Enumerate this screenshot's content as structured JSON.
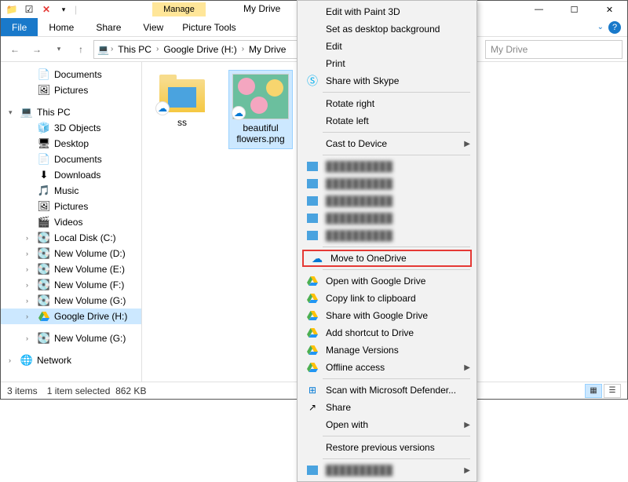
{
  "titlebar": {
    "manage": "Manage",
    "title": "My Drive",
    "min": "—",
    "max": "☐",
    "close": "✕"
  },
  "menu": {
    "file": "File",
    "home": "Home",
    "share": "Share",
    "view": "View",
    "picture_tools": "Picture Tools"
  },
  "nav": {
    "back": "←",
    "fwd": "→",
    "up": "↑",
    "crumbs": [
      "This PC",
      "Google Drive (H:)",
      "My Drive"
    ],
    "search_placeholder": "My Drive"
  },
  "tree": [
    {
      "icon": "📄",
      "label": "Documents",
      "sub": true
    },
    {
      "icon": "🖼",
      "label": "Pictures",
      "sub": true
    },
    {
      "spacer": true
    },
    {
      "icon": "💻",
      "label": "This PC",
      "arrow": "▾"
    },
    {
      "icon": "🧊",
      "label": "3D Objects",
      "sub": true
    },
    {
      "icon": "🖥",
      "label": "Desktop",
      "sub": true
    },
    {
      "icon": "📄",
      "label": "Documents",
      "sub": true
    },
    {
      "icon": "⬇",
      "label": "Downloads",
      "sub": true
    },
    {
      "icon": "🎵",
      "label": "Music",
      "sub": true
    },
    {
      "icon": "🖼",
      "label": "Pictures",
      "sub": true
    },
    {
      "icon": "🎬",
      "label": "Videos",
      "sub": true
    },
    {
      "icon": "💽",
      "label": "Local Disk (C:)",
      "sub": true,
      "arrow": "›"
    },
    {
      "icon": "💽",
      "label": "New Volume (D:)",
      "sub": true,
      "arrow": "›"
    },
    {
      "icon": "💽",
      "label": "New Volume (E:)",
      "sub": true,
      "arrow": "›"
    },
    {
      "icon": "💽",
      "label": "New Volume (F:)",
      "sub": true,
      "arrow": "›"
    },
    {
      "icon": "💽",
      "label": "New Volume (G:)",
      "sub": true,
      "arrow": "›"
    },
    {
      "icon": "▲",
      "label": "Google Drive (H:)",
      "sub": true,
      "arrow": "›",
      "selected": true,
      "gdrive": true
    },
    {
      "spacer": true
    },
    {
      "icon": "💽",
      "label": "New Volume (G:)",
      "sub": true,
      "arrow": "›"
    },
    {
      "spacer": true
    },
    {
      "icon": "🌐",
      "label": "Network",
      "arrow": "›"
    }
  ],
  "files": {
    "folder": "ss",
    "image": "beautiful flowers.png"
  },
  "status": {
    "items": "3 items",
    "selected": "1 item selected",
    "size": "862 KB"
  },
  "ctx": [
    {
      "label": "Edit with Paint 3D"
    },
    {
      "label": "Set as desktop background"
    },
    {
      "label": "Edit"
    },
    {
      "label": "Print"
    },
    {
      "label": "Share with Skype",
      "icon": "skype"
    },
    {
      "sep": true
    },
    {
      "label": "Rotate right"
    },
    {
      "label": "Rotate left"
    },
    {
      "sep": true
    },
    {
      "label": "Cast to Device",
      "arrow": true
    },
    {
      "sep": true
    },
    {
      "label": "blurred",
      "blur": true,
      "icon": "img"
    },
    {
      "label": "blurred",
      "blur": true,
      "icon": "img"
    },
    {
      "label": "blurred",
      "blur": true,
      "icon": "img"
    },
    {
      "label": "blurred",
      "blur": true,
      "icon": "img"
    },
    {
      "label": "blurred",
      "blur": true,
      "icon": "img"
    },
    {
      "sep": true
    },
    {
      "label": "Move to OneDrive",
      "icon": "onedrive",
      "highlight": true
    },
    {
      "sep": true
    },
    {
      "label": "Open with Google Drive",
      "icon": "gdrive"
    },
    {
      "label": "Copy link to clipboard",
      "icon": "gdrive"
    },
    {
      "label": "Share with Google Drive",
      "icon": "gdrive"
    },
    {
      "label": "Add shortcut to Drive",
      "icon": "gdrive"
    },
    {
      "label": "Manage Versions",
      "icon": "gdrive"
    },
    {
      "label": "Offline access",
      "icon": "gdrive",
      "arrow": true
    },
    {
      "sep": true
    },
    {
      "label": "Scan with Microsoft Defender...",
      "icon": "defender"
    },
    {
      "label": "Share",
      "icon": "share"
    },
    {
      "label": "Open with",
      "arrow": true
    },
    {
      "sep": true
    },
    {
      "label": "Restore previous versions"
    },
    {
      "sep": true
    },
    {
      "label": "blurred",
      "blur": true,
      "icon": "img",
      "arrow": true
    }
  ]
}
